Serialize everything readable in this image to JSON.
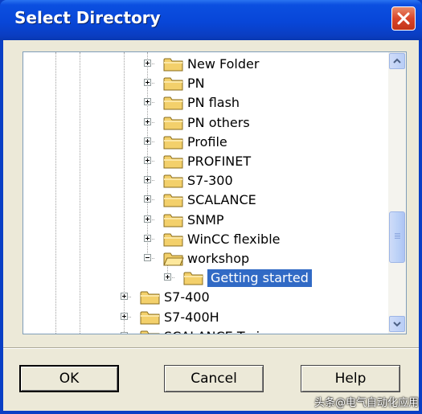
{
  "window": {
    "title": "Select Directory",
    "close_icon": "close-icon"
  },
  "tree": {
    "items": [
      {
        "label": "New Folder",
        "expanded": false,
        "selected": false
      },
      {
        "label": "PN",
        "expanded": false,
        "selected": false
      },
      {
        "label": "PN flash",
        "expanded": false,
        "selected": false
      },
      {
        "label": "PN others",
        "expanded": false,
        "selected": false
      },
      {
        "label": "Profile",
        "expanded": false,
        "selected": false
      },
      {
        "label": "PROFINET",
        "expanded": false,
        "selected": false
      },
      {
        "label": "S7-300",
        "expanded": false,
        "selected": false
      },
      {
        "label": "SCALANCE",
        "expanded": false,
        "selected": false
      },
      {
        "label": "SNMP",
        "expanded": false,
        "selected": false
      },
      {
        "label": "WinCC flexible",
        "expanded": false,
        "selected": false
      },
      {
        "label": "workshop",
        "expanded": true,
        "selected": false
      },
      {
        "label": "Getting started",
        "expanded": false,
        "selected": true
      },
      {
        "label": "S7-400",
        "expanded": false,
        "selected": false
      },
      {
        "label": "S7-400H",
        "expanded": false,
        "selected": false
      },
      {
        "label": "SCALANCE Train",
        "expanded": false,
        "selected": false
      }
    ],
    "selection_color": "#316ac5"
  },
  "buttons": {
    "ok": "OK",
    "cancel": "Cancel",
    "help": "Help"
  },
  "watermark": "头条@电气自动化应用"
}
